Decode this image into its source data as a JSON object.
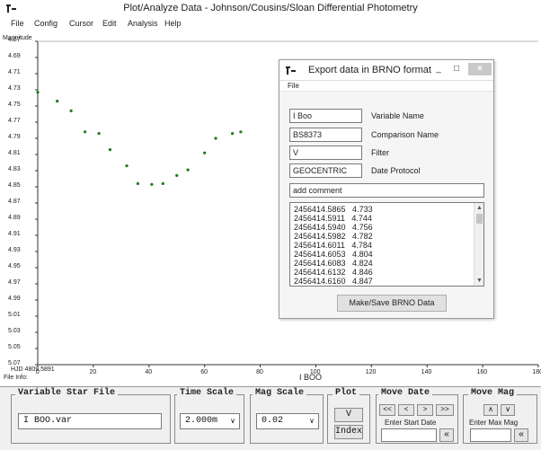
{
  "window": {
    "title": "Plot/Analyze Data - Johnson/Cousins/Sloan Differential Photometry",
    "menu": [
      "File",
      "Config",
      "Cursor",
      "Edit",
      "Analysis",
      "Help"
    ]
  },
  "plot": {
    "y_axis_title": "Magnitude",
    "x_axis_title": "I BOO",
    "hjd_label": "HJD 4809.5891",
    "file_info_label": "File Info:"
  },
  "chart_data": {
    "type": "scatter",
    "title": "",
    "xlabel": "I BOO",
    "ylabel": "Magnitude",
    "xlim": [
      0,
      180
    ],
    "ylim": [
      4.67,
      5.07
    ],
    "y_inverted": true,
    "grid": false,
    "x_ticks": [
      "0",
      "20",
      "40",
      "60",
      "80",
      "100",
      "120",
      "140",
      "160",
      "180"
    ],
    "y_ticks": [
      "4.67",
      "4.69",
      "4.71",
      "4.73",
      "4.75",
      "4.77",
      "4.79",
      "4.81",
      "4.83",
      "4.85",
      "4.87",
      "4.89",
      "4.91",
      "4.93",
      "4.95",
      "4.97",
      "4.99",
      "5.01",
      "5.03",
      "5.05",
      "5.07"
    ],
    "point_color": "#1b7a1b",
    "series": [
      {
        "x": [
          0,
          7,
          12,
          17,
          22,
          26,
          32,
          36,
          41,
          45,
          50,
          54,
          60,
          64,
          70,
          73
        ],
        "y": [
          4.733,
          4.744,
          4.756,
          4.782,
          4.784,
          4.804,
          4.824,
          4.846,
          4.847,
          4.846,
          4.836,
          4.829,
          4.808,
          4.79,
          4.784,
          4.782
        ]
      }
    ]
  },
  "bottom": {
    "variable_star_file": {
      "title": "Variable Star File",
      "value": "I BOO.var"
    },
    "time_scale": {
      "title": "Time Scale",
      "value": "2.000m"
    },
    "mag_scale": {
      "title": "Mag Scale",
      "value": "0.02"
    },
    "plot": {
      "title": "Plot",
      "v_button": "V",
      "index_button": "Index"
    },
    "move_date": {
      "title": "Move Date",
      "buttons": [
        "<<",
        "<",
        ">",
        ">>"
      ],
      "label": "Enter Start Date",
      "go": "«"
    },
    "move_mag": {
      "title": "Move Mag",
      "label": "Enter Max Mag",
      "go": "«"
    }
  },
  "dialog": {
    "title": "Export data in BRNO format",
    "menu": "File",
    "fields": [
      {
        "value": "I Boo",
        "label": "Variable Name"
      },
      {
        "value": "BS8373",
        "label": "Comparison Name"
      },
      {
        "value": "V",
        "label": "Filter"
      },
      {
        "value": "GEOCENTRIC",
        "label": "Date Protocol"
      }
    ],
    "comment_placeholder": "add comment",
    "data_rows": [
      "2456414.5865   4.733",
      "2456414.5911   4.744",
      "2456414.5940   4.756",
      "2456414.5982   4.782",
      "2456414.6011   4.784",
      "2456414.6053   4.804",
      "2456414.6083   4.824",
      "2456414.6132   4.846",
      "2456414.6160   4.847"
    ],
    "save_button": "Make/Save BRNO Data",
    "controls": {
      "minimize": "_",
      "maximize": "□",
      "close": "×"
    }
  }
}
